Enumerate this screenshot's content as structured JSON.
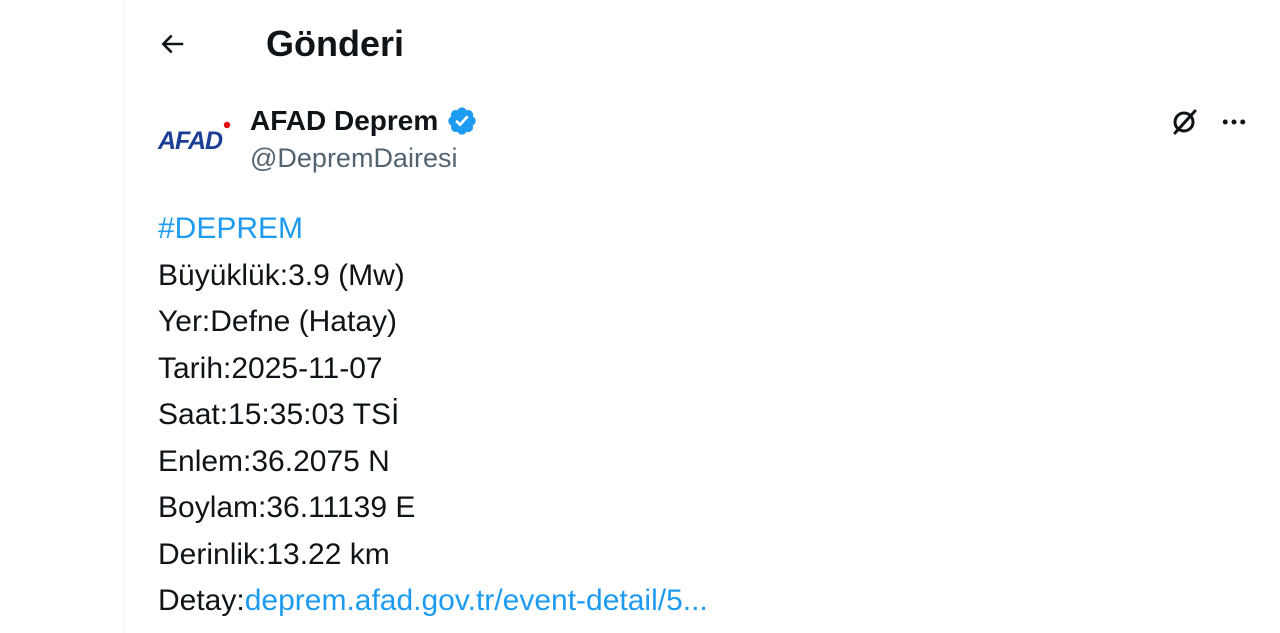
{
  "header": {
    "title": "Gönderi",
    "back_icon": "arrow-left-icon"
  },
  "author": {
    "avatar_text": "AFAD",
    "name": "AFAD Deprem",
    "handle": "@DepremDairesi",
    "verified_icon": "verified-badge-icon",
    "verified_color": "#1d9bf0"
  },
  "actions": {
    "grok_icon": "grok-icon",
    "more_icon": "more-horizontal-icon"
  },
  "tweet": {
    "hashtag": "#DEPREM",
    "magnitude": "Büyüklük:3.9 (Mw)",
    "location": "Yer:Defne (Hatay)",
    "date": "Tarih:2025-11-07",
    "time": "Saat:15:35:03 TSİ",
    "latitude": "Enlem:36.2075 N",
    "longitude": "Boylam:36.11139 E",
    "depth": "Derinlik:13.22 km",
    "detail_label": "Detay:",
    "detail_link": "deprem.afad.gov.tr/event-detail/5..."
  },
  "colors": {
    "text": "#0f1419",
    "secondary": "#536471",
    "link": "#1d9bf0",
    "afad_blue": "#1c3f95",
    "afad_red": "#e30613"
  }
}
